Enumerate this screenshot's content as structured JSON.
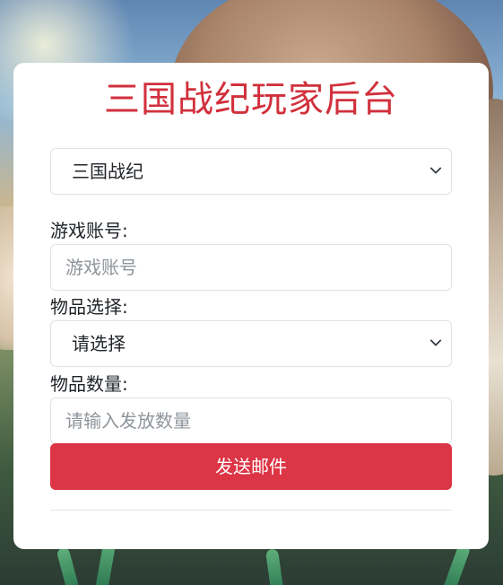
{
  "page_title": "三国战纪玩家后台",
  "game_select": {
    "value": "三国战纪"
  },
  "account": {
    "label": "游戏账号:",
    "placeholder": "游戏账号"
  },
  "item": {
    "label": "物品选择:",
    "value": "请选择"
  },
  "quantity": {
    "label": "物品数量:",
    "placeholder": "请输入发放数量"
  },
  "send_button": "发送邮件",
  "colors": {
    "title": "#d1303c",
    "button": "#dc3545"
  },
  "icons": {
    "select_arrow": "chevron-down-icon"
  }
}
